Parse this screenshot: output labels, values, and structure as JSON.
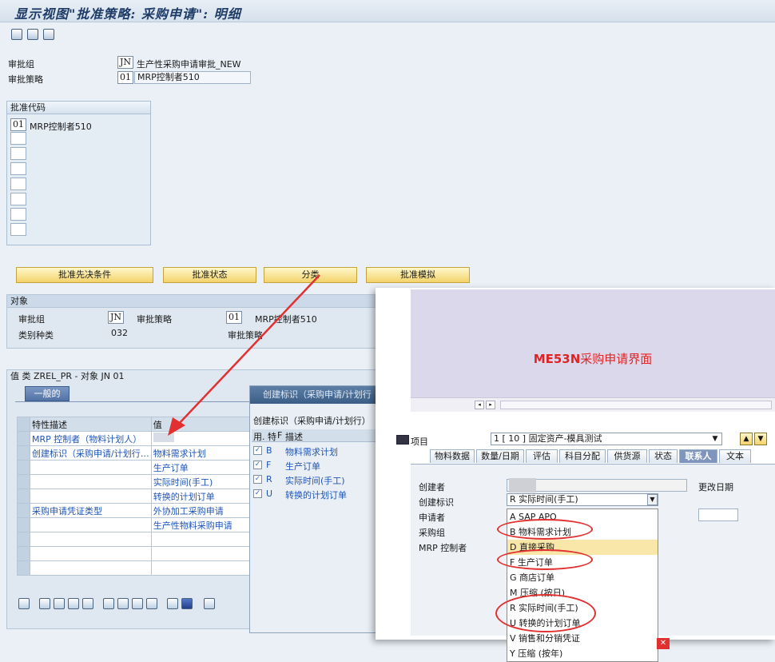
{
  "window": {
    "title": "显示视图\"批准策略: 采购申请\": 明细"
  },
  "header": {
    "group_label": "审批组",
    "group_code": "JN",
    "group_desc": "生产性采购申请审批_NEW",
    "strategy_label": "审批策略",
    "strategy_code": "01",
    "strategy_desc": "MRP控制者510"
  },
  "release_codes": {
    "title": "批准代码",
    "first_code": "01",
    "first_desc": "MRP控制者510"
  },
  "buttons": {
    "prereq": "批准先决条件",
    "status": "批准状态",
    "classify": "分类",
    "simulate": "批准模拟"
  },
  "object": {
    "title": "对象",
    "group_label": "审批组",
    "group_code": "JN",
    "strategy_label": "审批策略",
    "strategy_code": "01",
    "strategy_desc": "MRP控制者510",
    "class_type_label": "类别种类",
    "class_type_value": "032",
    "strategy_label2": "审批策略"
  },
  "values": {
    "title": "值 类 ZREL_PR - 对象 JN 01",
    "tab": "一般的",
    "col_desc": "特性描述",
    "col_value": "值",
    "rows": [
      {
        "desc": "MRP 控制者（物料计划人）",
        "value": ""
      },
      {
        "desc": "创建标识（采购申请/计划行…",
        "value": "物料需求计划"
      },
      {
        "desc": "",
        "value": "生产订单"
      },
      {
        "desc": "",
        "value": "实际时间(手工)"
      },
      {
        "desc": "",
        "value": "转换的计划订单"
      },
      {
        "desc": "采购申请凭证类型",
        "value": "外协加工采购申请"
      },
      {
        "desc": "",
        "value": "生产性物料采购申请"
      }
    ]
  },
  "popup": {
    "title": "创建标识（采购申请/计划行",
    "subtitle": "创建标识（采购申请/计划行）",
    "col_use": "用.",
    "col_mark": "特",
    "col_f": "F",
    "col_desc": "描述",
    "rows": [
      {
        "code": "B",
        "desc": "物料需求计划"
      },
      {
        "code": "F",
        "desc": "生产订单"
      },
      {
        "code": "R",
        "desc": "实际时间(手工)"
      },
      {
        "code": "U",
        "desc": "转换的计划订单"
      }
    ]
  },
  "overlay": {
    "caption_brand": "ME53N",
    "caption_rest": "采购申请界面",
    "item_label": "项目",
    "item_value": "1 [ 10 ] 固定资产-模具测试",
    "tabs": [
      "物料数据",
      "数量/日期",
      "评估",
      "科目分配",
      "供货源",
      "状态",
      "联系人",
      "文本"
    ],
    "creator_label": "创建者",
    "change_date_label": "更改日期",
    "create_ind_label": "创建标识",
    "create_ind_value": "R 实际时间(手工)",
    "requester_label": "申请者",
    "purch_group_label": "采购组",
    "mrp_label": "MRP 控制者",
    "options": [
      "A SAP APO",
      "B 物料需求计划",
      "D 直接采购",
      "F 生产订单",
      "G 商店订单",
      "M 压缩 (按日)",
      "R 实际时间(手工)",
      "U 转换的计划订单",
      "V 销售和分销凭证",
      "Y 压缩 (按年)"
    ],
    "highlighted_option": "D 直接采购"
  },
  "colors": {
    "accent_red": "#e23030",
    "caption_red": "#e02424",
    "selection_blue": "#1f55b8"
  }
}
